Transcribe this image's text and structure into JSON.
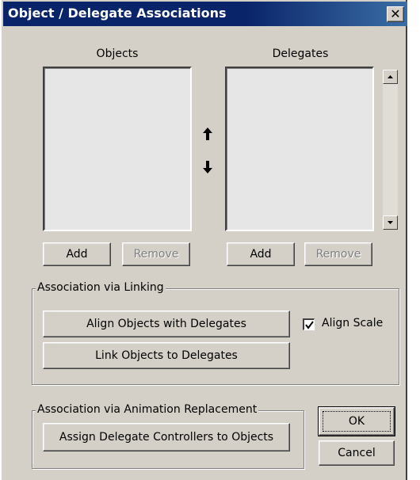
{
  "window": {
    "title": "Object / Delegate Associations",
    "close_glyph": "✕"
  },
  "lists": {
    "objects_label": "Objects",
    "delegates_label": "Delegates",
    "objects_add": "Add",
    "objects_remove": "Remove",
    "delegates_add": "Add",
    "delegates_remove": "Remove"
  },
  "linking": {
    "group_title": "Association via Linking",
    "align_button": "Align Objects with Delegates",
    "link_button": "Link Objects to Delegates",
    "align_scale_label": "Align Scale",
    "align_scale_checked": true
  },
  "replacement": {
    "group_title": "Association via Animation Replacement",
    "assign_button": "Assign Delegate Controllers to Objects"
  },
  "dialog_buttons": {
    "ok": "OK",
    "cancel": "Cancel"
  },
  "icons": {
    "up": "arrow-up-icon",
    "down": "arrow-down-icon",
    "scroll_up": "scroll-up-icon",
    "scroll_down": "scroll-down-icon"
  }
}
